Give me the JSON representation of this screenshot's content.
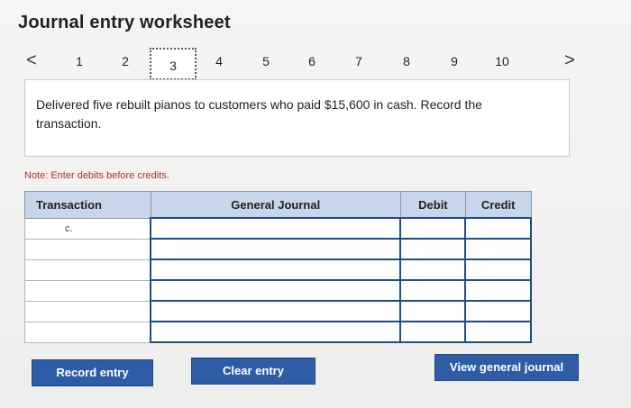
{
  "header": {
    "title": "Journal entry worksheet"
  },
  "nav": {
    "prev_label": "<",
    "next_label": ">",
    "pages": [
      "1",
      "2",
      "3",
      "4",
      "5",
      "6",
      "7",
      "8",
      "9",
      "10"
    ],
    "active_page": "3"
  },
  "question": {
    "text": "Delivered five rebuilt pianos to customers who paid $15,600 in cash. Record the transaction."
  },
  "note": "Note: Enter debits before credits.",
  "table": {
    "headers": [
      "Transaction",
      "General Journal",
      "Debit",
      "Credit"
    ],
    "rows": [
      {
        "transaction": "c.",
        "account": "",
        "debit": "",
        "credit": ""
      },
      {
        "transaction": "",
        "account": "",
        "debit": "",
        "credit": ""
      },
      {
        "transaction": "",
        "account": "",
        "debit": "",
        "credit": ""
      },
      {
        "transaction": "",
        "account": "",
        "debit": "",
        "credit": ""
      },
      {
        "transaction": "",
        "account": "",
        "debit": "",
        "credit": ""
      },
      {
        "transaction": "",
        "account": "",
        "debit": "",
        "credit": ""
      }
    ]
  },
  "buttons": {
    "record": "Record entry",
    "clear": "Clear entry",
    "view": "View general journal"
  },
  "colors": {
    "button_bg": "#2e5da5",
    "header_bg": "#c7d6ea",
    "note": "#a3352b",
    "input_border": "#1f4e87"
  }
}
